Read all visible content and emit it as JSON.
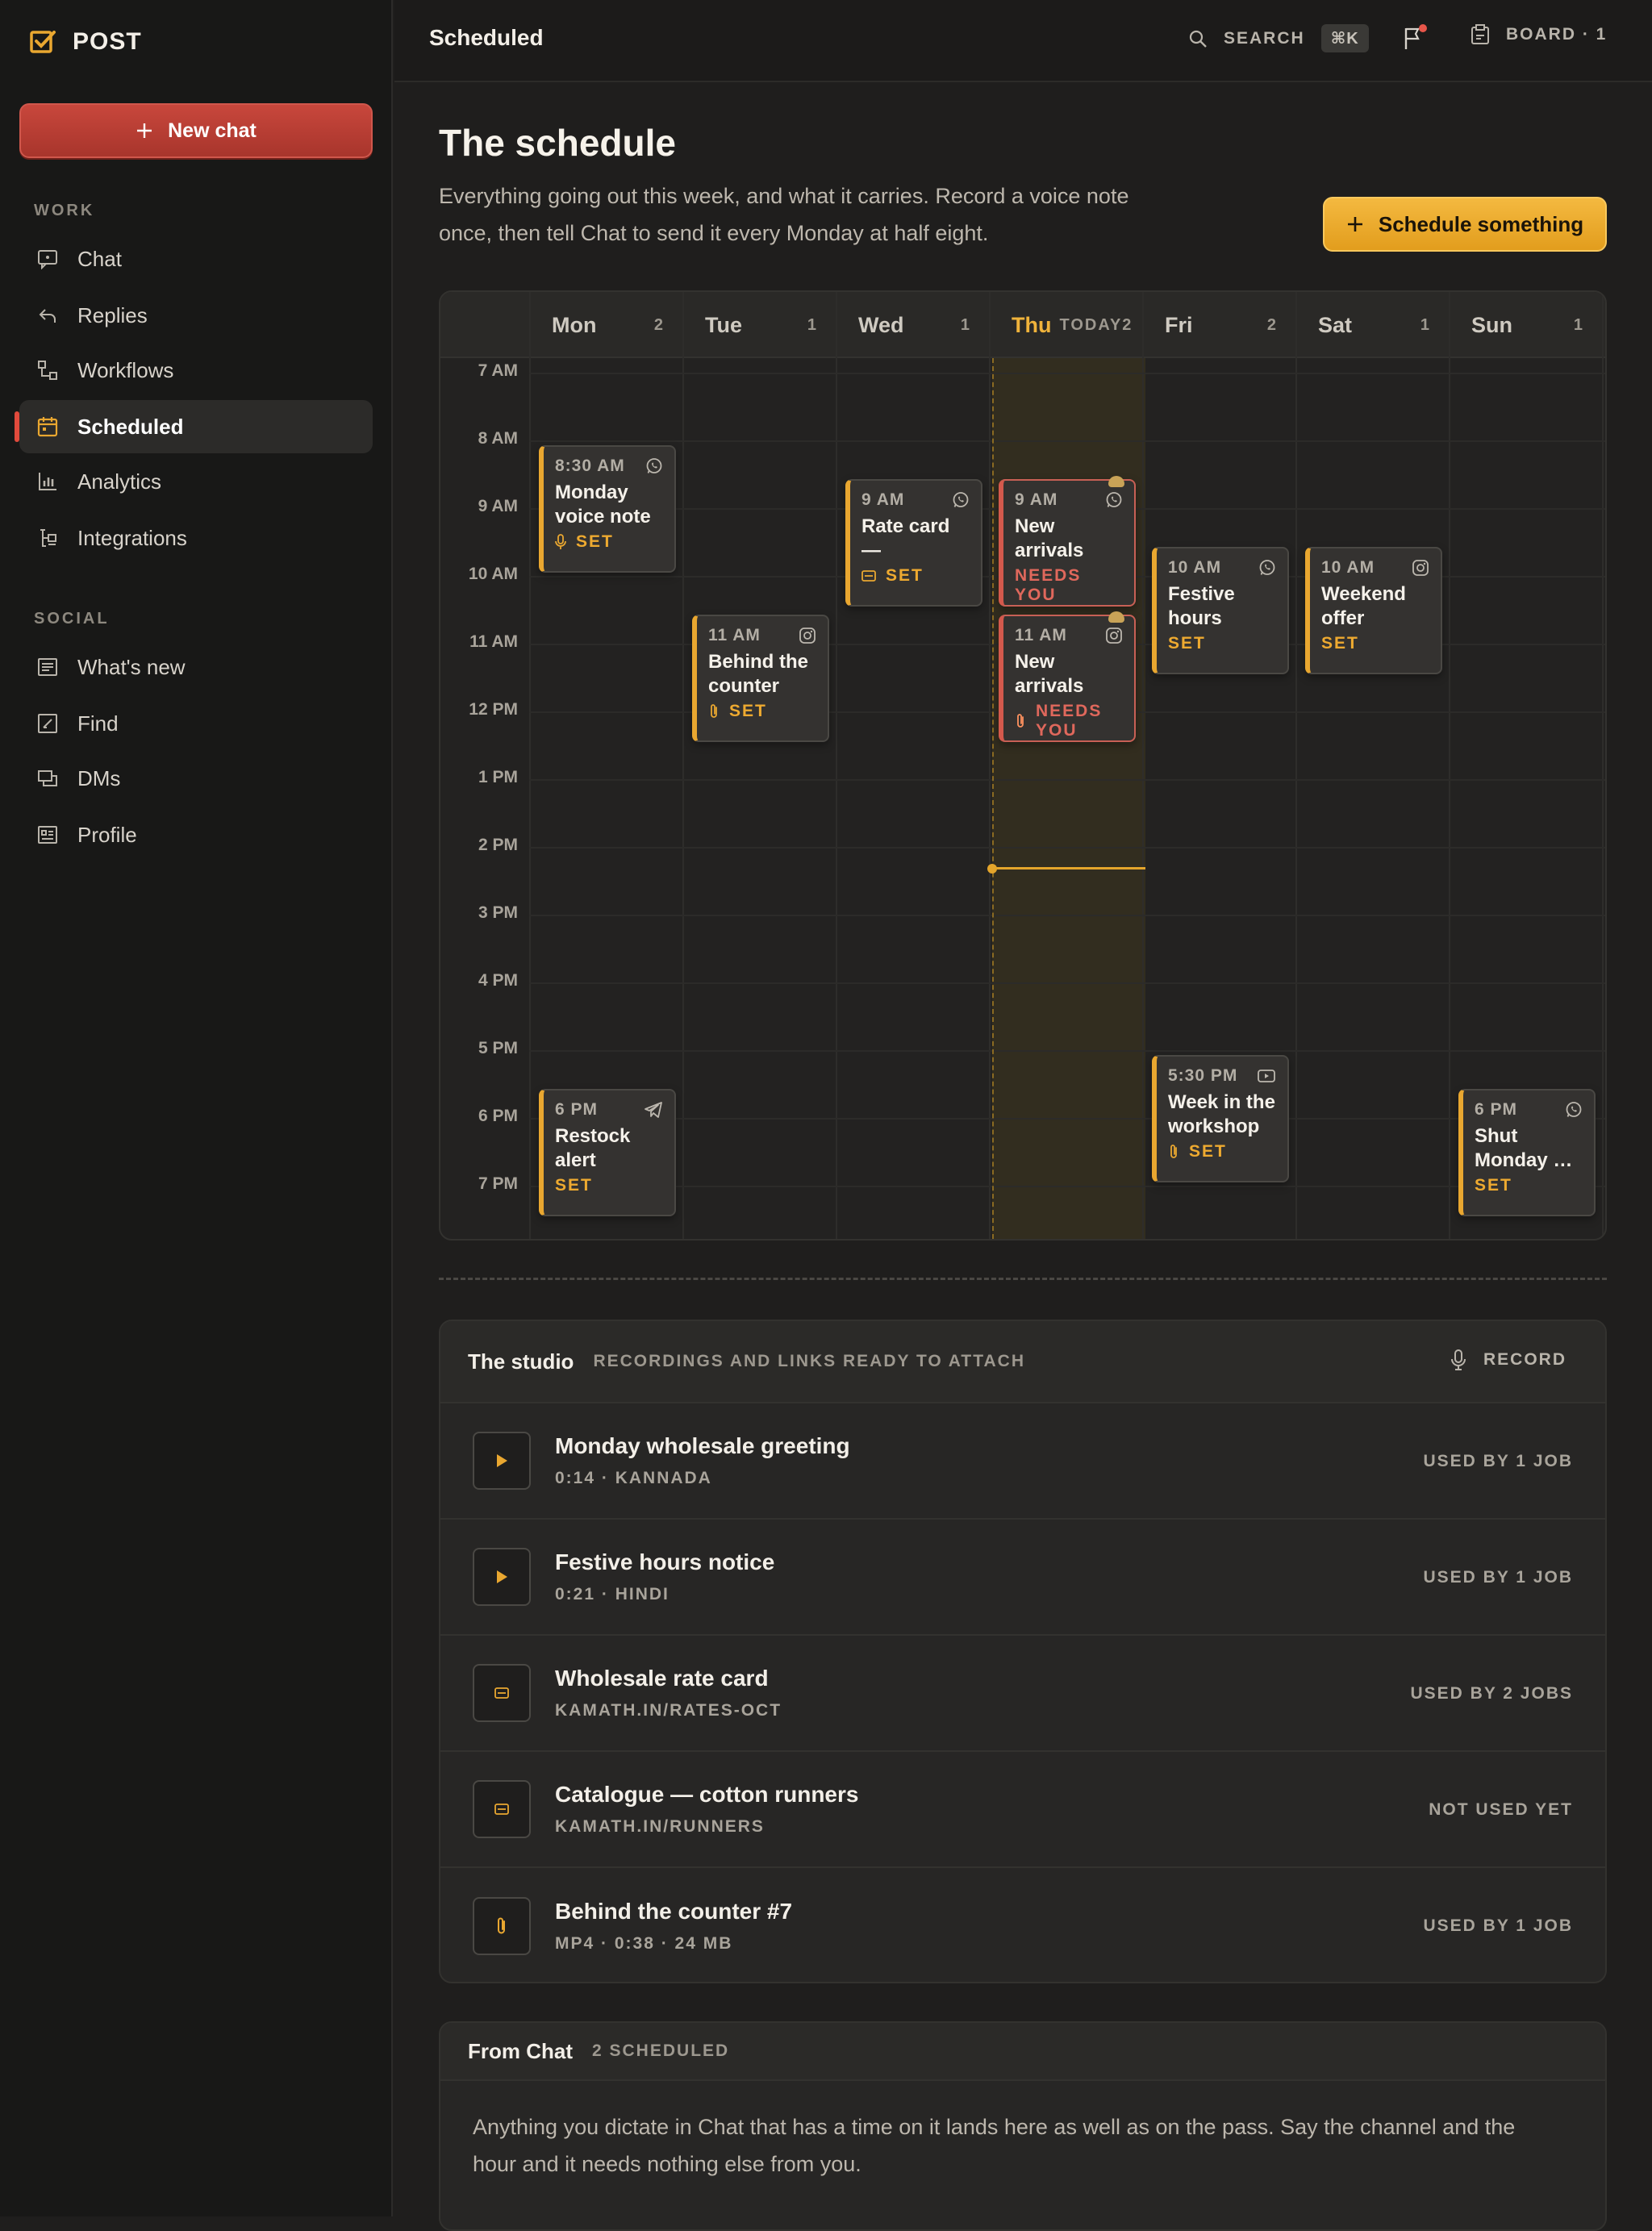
{
  "brand": {
    "name": "POST"
  },
  "sidebar": {
    "new_chat_label": "New chat",
    "work_label": "WORK",
    "social_label": "SOCIAL",
    "work_items": [
      {
        "label": "Chat",
        "icon": "chat-icon"
      },
      {
        "label": "Replies",
        "icon": "reply-icon"
      },
      {
        "label": "Workflows",
        "icon": "workflow-icon"
      },
      {
        "label": "Scheduled",
        "icon": "calendar-icon",
        "active": true
      },
      {
        "label": "Analytics",
        "icon": "analytics-icon"
      },
      {
        "label": "Integrations",
        "icon": "integrations-icon"
      }
    ],
    "social_items": [
      {
        "label": "What's new",
        "icon": "feed-icon"
      },
      {
        "label": "Find",
        "icon": "find-icon"
      },
      {
        "label": "DMs",
        "icon": "dm-icon"
      },
      {
        "label": "Profile",
        "icon": "profile-icon"
      }
    ]
  },
  "topbar": {
    "title": "Scheduled",
    "search_label": "SEARCH",
    "search_shortcut": "⌘K",
    "board_label": "BOARD · 1"
  },
  "header": {
    "title": "The schedule",
    "description": "Everything going out this week, and what it carries. Record a voice note once, then tell Chat to send it every Monday at half eight.",
    "schedule_button": "Schedule something"
  },
  "calendar": {
    "today_label": "TODAY",
    "days": [
      {
        "name": "Mon",
        "count": "2"
      },
      {
        "name": "Tue",
        "count": "1"
      },
      {
        "name": "Wed",
        "count": "1"
      },
      {
        "name": "Thu",
        "count": "2",
        "today": true
      },
      {
        "name": "Fri",
        "count": "2"
      },
      {
        "name": "Sat",
        "count": "1"
      },
      {
        "name": "Sun",
        "count": "1"
      }
    ],
    "hours": [
      "7 AM",
      "8 AM",
      "9 AM",
      "10 AM",
      "11 AM",
      "12 PM",
      "1 PM",
      "2 PM",
      "3 PM",
      "4 PM",
      "5 PM",
      "6 PM",
      "7 PM"
    ],
    "now_hour": 14.3,
    "events": [
      {
        "day": 0,
        "start": 8.5,
        "time": "8:30 AM",
        "title": "Monday voice note",
        "status": "SET",
        "channel": "whatsapp-icon",
        "attach": "mic-icon"
      },
      {
        "day": 0,
        "start": 18,
        "time": "6 PM",
        "title": "Restock alert",
        "status": "SET",
        "channel": "telegram-icon"
      },
      {
        "day": 1,
        "start": 11,
        "time": "11 AM",
        "title": "Behind the counter",
        "status": "SET",
        "channel": "instagram-icon",
        "attach": "paperclip-icon"
      },
      {
        "day": 2,
        "start": 9,
        "time": "9 AM",
        "title": "Rate card — wholesale",
        "status": "SET",
        "channel": "whatsapp-icon",
        "attach": "link-icon"
      },
      {
        "day": 3,
        "start": 9,
        "time": "9 AM",
        "title": "New arrivals",
        "status": "NEEDS YOU",
        "channel": "whatsapp-icon",
        "needs": true
      },
      {
        "day": 3,
        "start": 11,
        "time": "11 AM",
        "title": "New arrivals",
        "status": "NEEDS YOU",
        "channel": "instagram-icon",
        "attach": "paperclip-icon",
        "needs": true
      },
      {
        "day": 4,
        "start": 10,
        "time": "10 AM",
        "title": "Festive hours",
        "status": "SET",
        "channel": "whatsapp-icon"
      },
      {
        "day": 4,
        "start": 17.5,
        "time": "5:30 PM",
        "title": "Week in the workshop",
        "status": "SET",
        "channel": "youtube-icon",
        "attach": "paperclip-icon"
      },
      {
        "day": 5,
        "start": 10,
        "time": "10 AM",
        "title": "Weekend offer",
        "status": "SET",
        "channel": "instagram-icon"
      },
      {
        "day": 6,
        "start": 18,
        "time": "6 PM",
        "title": "Shut Monday …",
        "status": "SET",
        "channel": "whatsapp-icon"
      }
    ]
  },
  "studio": {
    "title": "The studio",
    "subtitle": "RECORDINGS AND LINKS READY TO ATTACH",
    "record_label": "RECORD",
    "assets": [
      {
        "title": "Monday wholesale greeting",
        "meta": "0:14 · KANNADA",
        "used": "USED BY 1 JOB",
        "icon": "play-icon"
      },
      {
        "title": "Festive hours notice",
        "meta": "0:21 · HINDI",
        "used": "USED BY 1 JOB",
        "icon": "play-icon"
      },
      {
        "title": "Wholesale rate card",
        "meta": "KAMATH.IN/RATES-OCT",
        "used": "USED BY 2 JOBS",
        "icon": "link-icon"
      },
      {
        "title": "Catalogue — cotton runners",
        "meta": "KAMATH.IN/RUNNERS",
        "used": "NOT USED YET",
        "icon": "link-icon"
      },
      {
        "title": "Behind the counter #7",
        "meta": "MP4 · 0:38 · 24 MB",
        "used": "USED BY 1 JOB",
        "icon": "paperclip-icon"
      }
    ]
  },
  "from_chat": {
    "title": "From Chat",
    "subtitle": "2 SCHEDULED",
    "body": "Anything you dictate in Chat that has a time on it lands here as well as on the pass. Say the channel and the hour and it needs nothing else from you."
  },
  "colors": {
    "accent": "#e9a730",
    "danger": "#d3594c",
    "brand_red": "#c8473c"
  }
}
